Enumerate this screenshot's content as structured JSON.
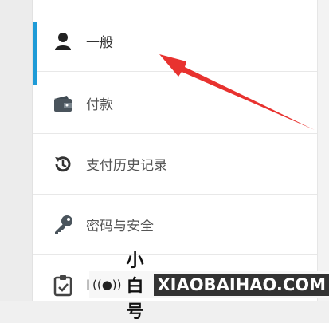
{
  "sidebar": {
    "items": [
      {
        "label": "一般",
        "icon": "person-icon",
        "active": true
      },
      {
        "label": "付款",
        "icon": "wallet-icon",
        "active": false
      },
      {
        "label": "支付历史记录",
        "icon": "history-icon",
        "active": false
      },
      {
        "label": "密码与安全",
        "icon": "key-icon",
        "active": false
      },
      {
        "label": "I",
        "icon": "clipboard-check-icon",
        "active": false
      }
    ]
  },
  "watermark": {
    "cn": "小白号",
    "en": "XIAOBAIHAO.COM"
  },
  "colors": {
    "accent": "#1e9bd7",
    "annotation_arrow": "#e8322f"
  }
}
